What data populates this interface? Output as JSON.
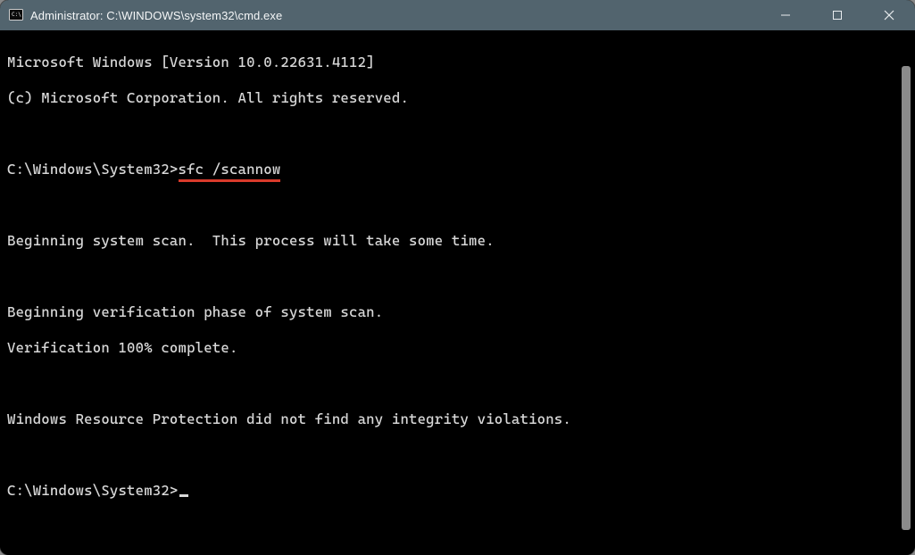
{
  "titlebar": {
    "title": "Administrator: C:\\WINDOWS\\system32\\cmd.exe"
  },
  "terminal": {
    "header1": "Microsoft Windows [Version 10.0.22631.4112]",
    "header2": "(c) Microsoft Corporation. All rights reserved.",
    "prompt1_path": "C:\\Windows\\System32>",
    "prompt1_cmd": "sfc /scannow",
    "line_scan": "Beginning system scan.  This process will take some time.",
    "line_verif1": "Beginning verification phase of system scan.",
    "line_verif2": "Verification 100% complete.",
    "line_result": "Windows Resource Protection did not find any integrity violations.",
    "prompt2_path": "C:\\Windows\\System32>"
  }
}
